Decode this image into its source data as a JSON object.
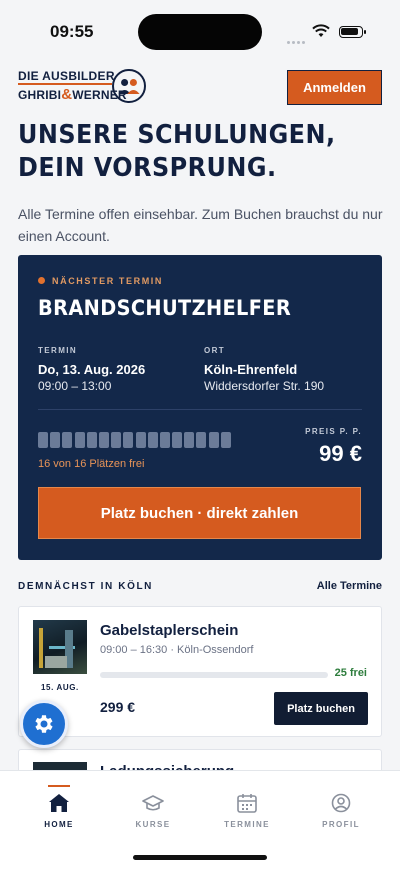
{
  "status_bar": {
    "time": "09:55"
  },
  "header": {
    "logo_line1": "DIE AUSBILDER",
    "logo_line2_a": "GHRIBI",
    "logo_amp": "&",
    "logo_line2_b": "WERNER",
    "login_label": "Anmelden"
  },
  "hero": {
    "headline_line1": "UNSERE SCHULUNGEN,",
    "headline_line2": "DEIN VORSPRUNG.",
    "intro": "Alle Termine offen einsehbar. Zum Buchen brauchst du nur einen Account."
  },
  "next_event": {
    "eyebrow": "NÄCHSTER TERMIN",
    "course": "BRANDSCHUTZHELFER",
    "date_label": "TERMIN",
    "date": "Do, 13. Aug. 2026",
    "time": "09:00 – 13:00",
    "place_label": "ORT",
    "place": "Köln-Ehrenfeld",
    "address": "Widdersdorfer Str. 190",
    "seats_total": 16,
    "seats_free": 16,
    "seats_text": "16 von 16 Plätzen frei",
    "price_label": "PREIS P. P.",
    "price": "99 €",
    "book_label": "Platz buchen · direkt zahlen"
  },
  "upcoming": {
    "title": "DEMNÄCHST IN KÖLN",
    "all_link": "Alle Termine",
    "items": [
      {
        "date": "15. AUG.",
        "title": "Gabelstaplerschein",
        "meta": "09:00 – 16:30 · Köln-Ossendorf",
        "booked_fraction": 0,
        "free": "25 frei",
        "price": "299 €",
        "button": "Platz buchen"
      },
      {
        "title": "Ladungssicherung"
      }
    ]
  },
  "tabbar": {
    "tabs": [
      {
        "label": "HOME",
        "icon": "home-icon",
        "active": true
      },
      {
        "label": "KURSE",
        "icon": "graduation-cap-icon",
        "active": false
      },
      {
        "label": "TERMINE",
        "icon": "calendar-icon",
        "active": false
      },
      {
        "label": "PROFIL",
        "icon": "profile-icon",
        "active": false
      }
    ]
  },
  "colors": {
    "navy": "#13284a",
    "accent": "#d55b1f",
    "fab": "#1f6fd1",
    "success": "#2e7d3d"
  }
}
